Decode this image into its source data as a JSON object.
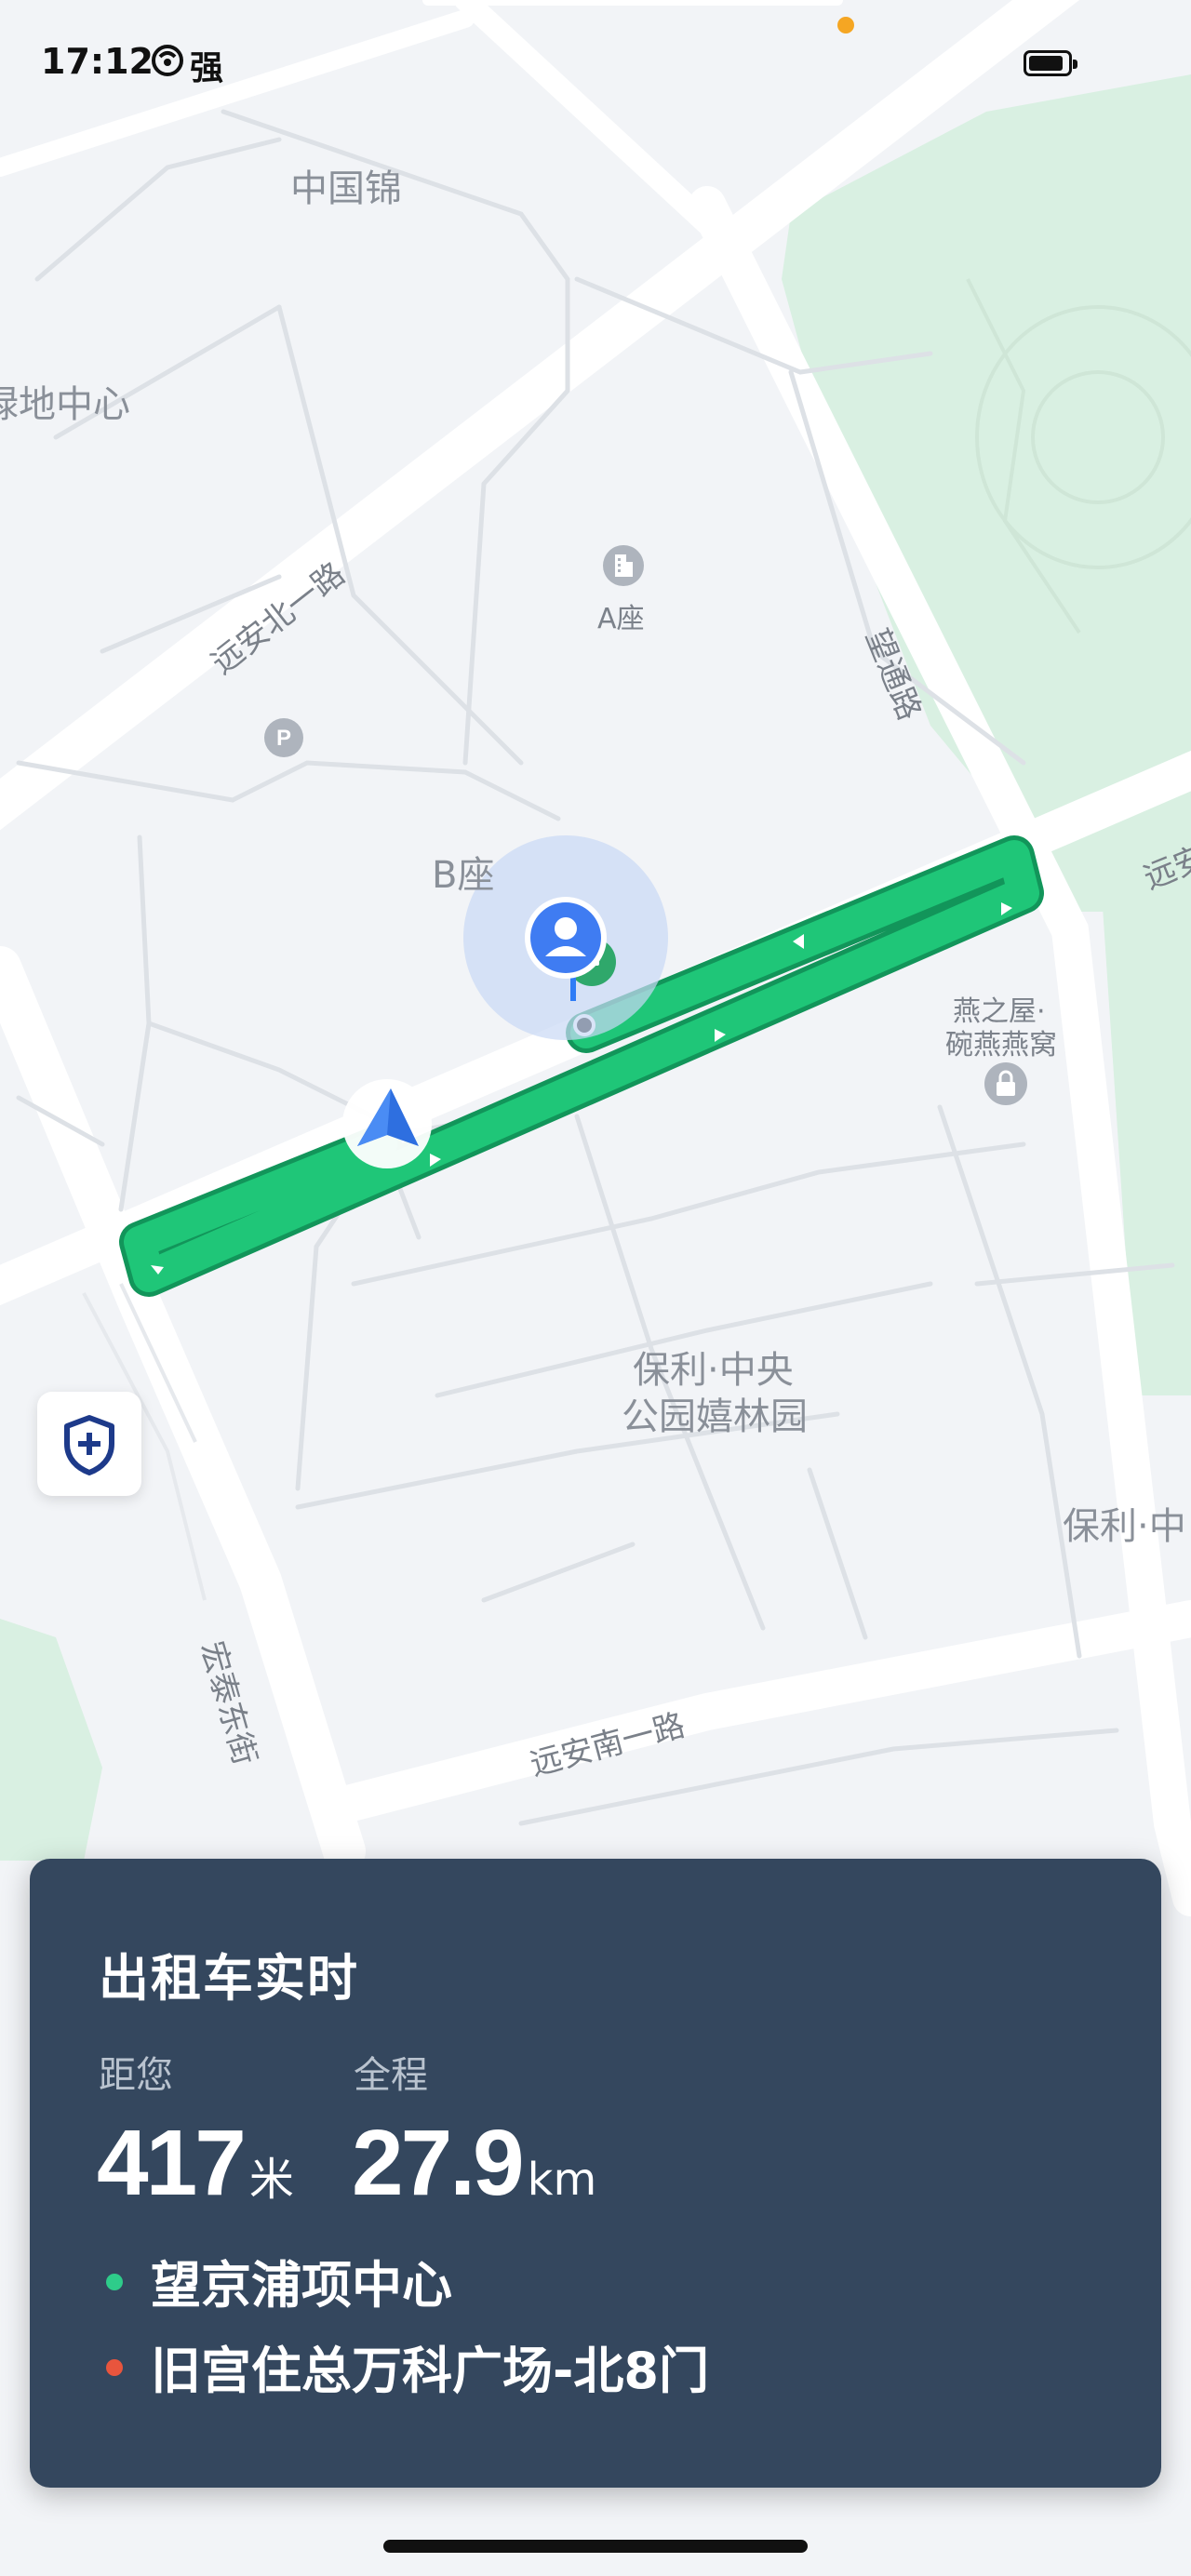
{
  "status_bar": {
    "time": "17:12",
    "carrier": "强"
  },
  "map": {
    "labels": {
      "zhongguojin": "中国锦",
      "lvdi": "绿地中心",
      "a_zuo": "A座",
      "b_zuo": "B座",
      "yanzhiwu_line1": "燕之屋·",
      "yanzhiwu_line2": "碗燕燕窝",
      "poly_line1": "保利·中央",
      "poly_line2": "公园嬉林园",
      "poly_right": "保利·中"
    },
    "roads": {
      "yuanan_north": "远安北一路",
      "wangtong": "望通路",
      "yuanan_right": "远安",
      "hongtai": "宏泰东街",
      "yuanan_south": "远安南一路"
    },
    "route_color": "#1fc678",
    "route_outline": "#12955a",
    "map_background": "#f2f4f7",
    "park_color": "#d9f0e2"
  },
  "card": {
    "title": "出租车实时",
    "distance_label": "距您",
    "distance_value": "417",
    "distance_unit": "米",
    "total_label": "全程",
    "total_value": "27.9",
    "total_unit": "km",
    "origin": "望京浦项中心",
    "destination": "旧宫住总万科广场-北8门",
    "origin_color": "#2ecc8a",
    "destination_color": "#e8553d",
    "background": "#34475e"
  },
  "icons": {
    "safety": "shield-plus-icon",
    "car": "navigation-arrow-icon",
    "user": "user-location-icon",
    "parking": "parking-icon",
    "building": "building-icon",
    "lock": "lock-icon"
  }
}
